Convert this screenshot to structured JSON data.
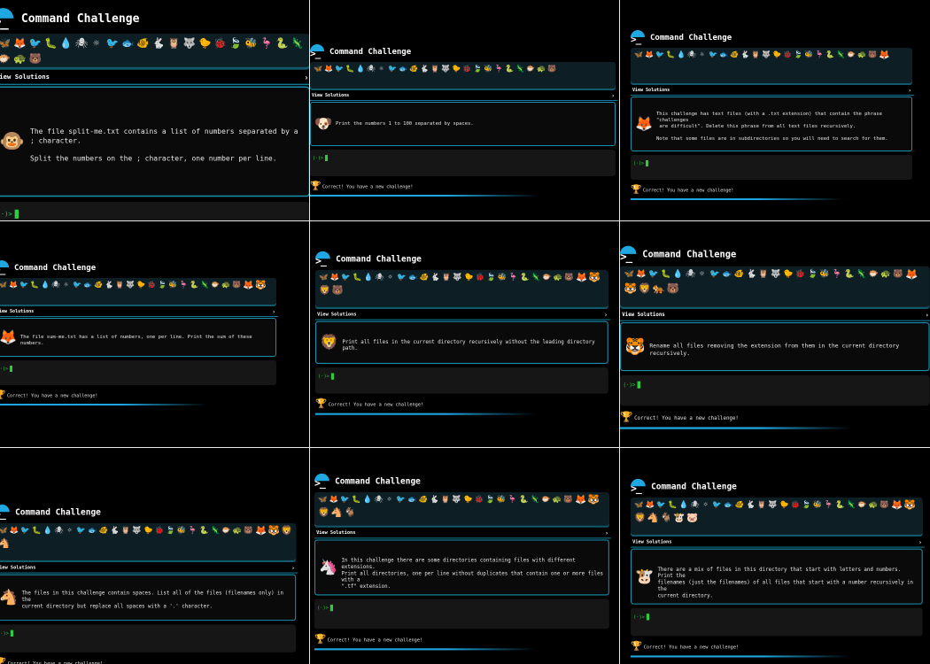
{
  "app": {
    "title": "Command Challenge",
    "logo_glyph": ">_",
    "view_solutions": "View Solutions",
    "chevron": "›",
    "prompt": "(̲)>",
    "status": "Correct! You have a new challenge!",
    "colors": {
      "background": "#000000",
      "accent": "#1ea7e1",
      "panel_border": "#1b8fae",
      "strip_bg": "#0d1f25",
      "cursor": "#2ecc40",
      "terminal_bg": "#161616"
    },
    "animal_icons": [
      "dragonfly-icon",
      "fox-icon",
      "bird-icon",
      "worm-icon",
      "drop-icon",
      "spider-icon",
      "sun-icon",
      "bird-blue-icon",
      "fish-icon",
      "fish2-icon",
      "hare-icon",
      "owl-icon",
      "wolf-icon",
      "bird-green-icon",
      "ladybug-icon",
      "leaf-icon",
      "bee-icon",
      "crane-icon",
      "snake-icon",
      "lizard-icon",
      "fish-red-icon",
      "tortoise-icon",
      "bear-icon"
    ]
  },
  "tiles": [
    {
      "avatar": "monkey-icon",
      "avatar_color": "#3a2a1c",
      "row2": [],
      "text": "The file split-me.txt contains a list of numbers separated by a ; character.\n\nSplit the numbers on the ; character, one number per line."
    },
    {
      "avatar": "dog-icon",
      "avatar_color": "#b3651c",
      "row2": [],
      "text": "Print the numbers 1 to 100 separated by spaces."
    },
    {
      "avatar": "fox-icon",
      "avatar_color": "#c5531d",
      "row2": [
        "fox-icon"
      ],
      "text": "This challenge has text files (with a .txt extension) that contain the phrase \"challenges\n are difficult\". Delete this phrase from all text files recursively.\n\nNote that some files are in subdirectories so you will need to search for them."
    },
    {
      "avatar": "fox-icon",
      "avatar_color": "#c5531d",
      "row2": [
        "fox-icon",
        "tiger-icon"
      ],
      "text": "The file sum-me.txt has a list of numbers, one per line. Print the sum of these numbers."
    },
    {
      "avatar": "lion-icon",
      "avatar_color": "#c8892f",
      "row2": [
        "fox-icon",
        "tiger-icon",
        "lion-icon",
        "bear-icon"
      ],
      "text": "Print all files in the current directory recursively without the leading directory path."
    },
    {
      "avatar": "tiger-icon",
      "avatar_color": "#d66a1c",
      "row2": [
        "fox-icon",
        "tiger-icon",
        "lion-icon",
        "tiger2-icon",
        "bear-icon"
      ],
      "text": "Rename all files removing the extension from them in the current directory recursively."
    },
    {
      "avatar": "horse-icon",
      "avatar_color": "#6b3a1d",
      "row2": [
        "fox-icon",
        "tiger-icon",
        "lion-icon",
        "horse-icon"
      ],
      "text": "The files in this challenge contain spaces. List all of the files (filenames only) in the\ncurrent directory but replace all spaces with a '.' character."
    },
    {
      "avatar": "unicorn-icon",
      "avatar_color": "#1e90c8",
      "row2": [
        "fox-icon",
        "tiger-icon",
        "lion-icon",
        "horse-icon",
        "goat-icon"
      ],
      "text": "In this challenge there are some directories containing files with different extensions.\nPrint all directories, one per line without duplicates that contain one or more files with a\n\".tf\" extension."
    },
    {
      "avatar": "cow-icon",
      "avatar_color": "#8a6b4a",
      "row2": [
        "fox-icon",
        "tiger-icon",
        "lion-icon",
        "horse-icon",
        "goat-icon",
        "cow-icon",
        "pig-icon"
      ],
      "text": "There are a mix of files in this directory that start with letters and numbers. Print the\nfilenames (just the filenames) of all files that start with a number recursively in the\ncurrent directory."
    }
  ]
}
